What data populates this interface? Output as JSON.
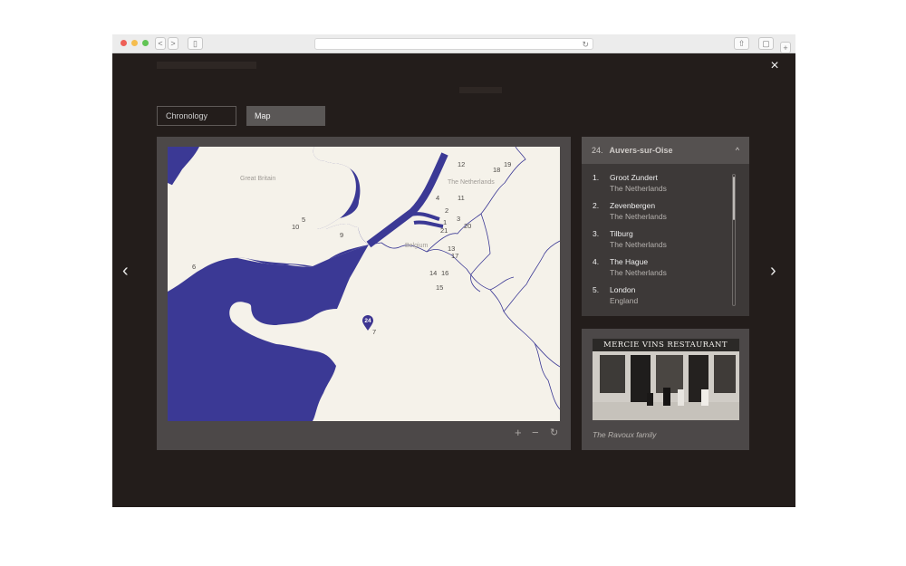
{
  "map_view": {
    "tabs": {
      "chronology": "Chronology",
      "map": "Map"
    },
    "regions": {
      "great_britain": "Great Britain",
      "netherlands": "The Netherlands",
      "belgium": "Belgium"
    },
    "location_markers": [
      "12",
      "18",
      "19",
      "11",
      "4",
      "2",
      "3",
      "20",
      "1",
      "21",
      "5",
      "10",
      "9",
      "13",
      "17",
      "14",
      "16",
      "15",
      "6",
      "7"
    ],
    "selected_marker": "24",
    "accent_color": "#3d3591"
  },
  "location_panel": {
    "selected": {
      "number": "24.",
      "name": "Auvers-sur-Oise"
    },
    "items": [
      {
        "number": "1.",
        "name": "Groot Zundert",
        "country": "The Netherlands"
      },
      {
        "number": "2.",
        "name": "Zevenbergen",
        "country": "The Netherlands"
      },
      {
        "number": "3.",
        "name": "Tilburg",
        "country": "The Netherlands"
      },
      {
        "number": "4.",
        "name": "The Hague",
        "country": "The Netherlands"
      },
      {
        "number": "5.",
        "name": "London",
        "country": "England"
      }
    ]
  },
  "photo": {
    "sign": "MERCIE VINS RESTAURANT",
    "caption": "The Ravoux family"
  },
  "icons": {
    "close": "×",
    "previous": "‹",
    "next": "›",
    "zoom_in": "+",
    "zoom_out": "−",
    "reset": "↻",
    "collapse": "^"
  }
}
